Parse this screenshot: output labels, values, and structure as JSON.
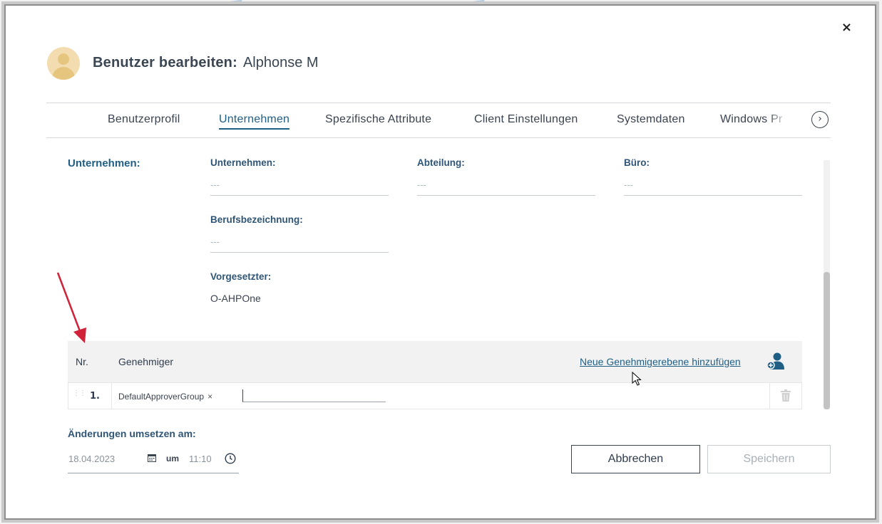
{
  "dialog": {
    "close_label": "×",
    "title_label": "Benutzer bearbeiten:",
    "user_name": "Alphonse M"
  },
  "tabs": [
    {
      "label": "Benutzerprofil",
      "active": false
    },
    {
      "label": "Unternehmen",
      "active": true
    },
    {
      "label": "Spezifische Attribute",
      "active": false
    },
    {
      "label": "Client Einstellungen",
      "active": false
    },
    {
      "label": "Systemdaten",
      "active": false
    },
    {
      "label": "Windows Pr",
      "active": false
    }
  ],
  "tab_next_label": "›",
  "section": {
    "title": "Unternehmen:",
    "fields": {
      "company": {
        "label": "Unternehmen:",
        "value": "---"
      },
      "department": {
        "label": "Abteilung:",
        "value": "---"
      },
      "office": {
        "label": "Büro:",
        "value": "---"
      },
      "job_title": {
        "label": "Berufsbezeichnung:",
        "value": "---"
      },
      "manager": {
        "label": "Vorgesetzter:",
        "value": "O-AHPOne"
      }
    }
  },
  "approvers": {
    "col_nr": "Nr.",
    "col_approver": "Genehmiger",
    "add_link": "Neue Genehmigerebene hinzufügen",
    "rows": [
      {
        "nr": "1.",
        "chip": "DefaultApproverGroup",
        "chip_remove": "×"
      }
    ]
  },
  "schedule": {
    "label": "Änderungen umsetzen am:",
    "date": "18.04.2023",
    "at_label": "um",
    "time": "11:10"
  },
  "buttons": {
    "cancel": "Abbrechen",
    "save": "Speichern"
  },
  "colors": {
    "accent": "#1f5f86",
    "annotation_arrow": "#d0233a"
  }
}
